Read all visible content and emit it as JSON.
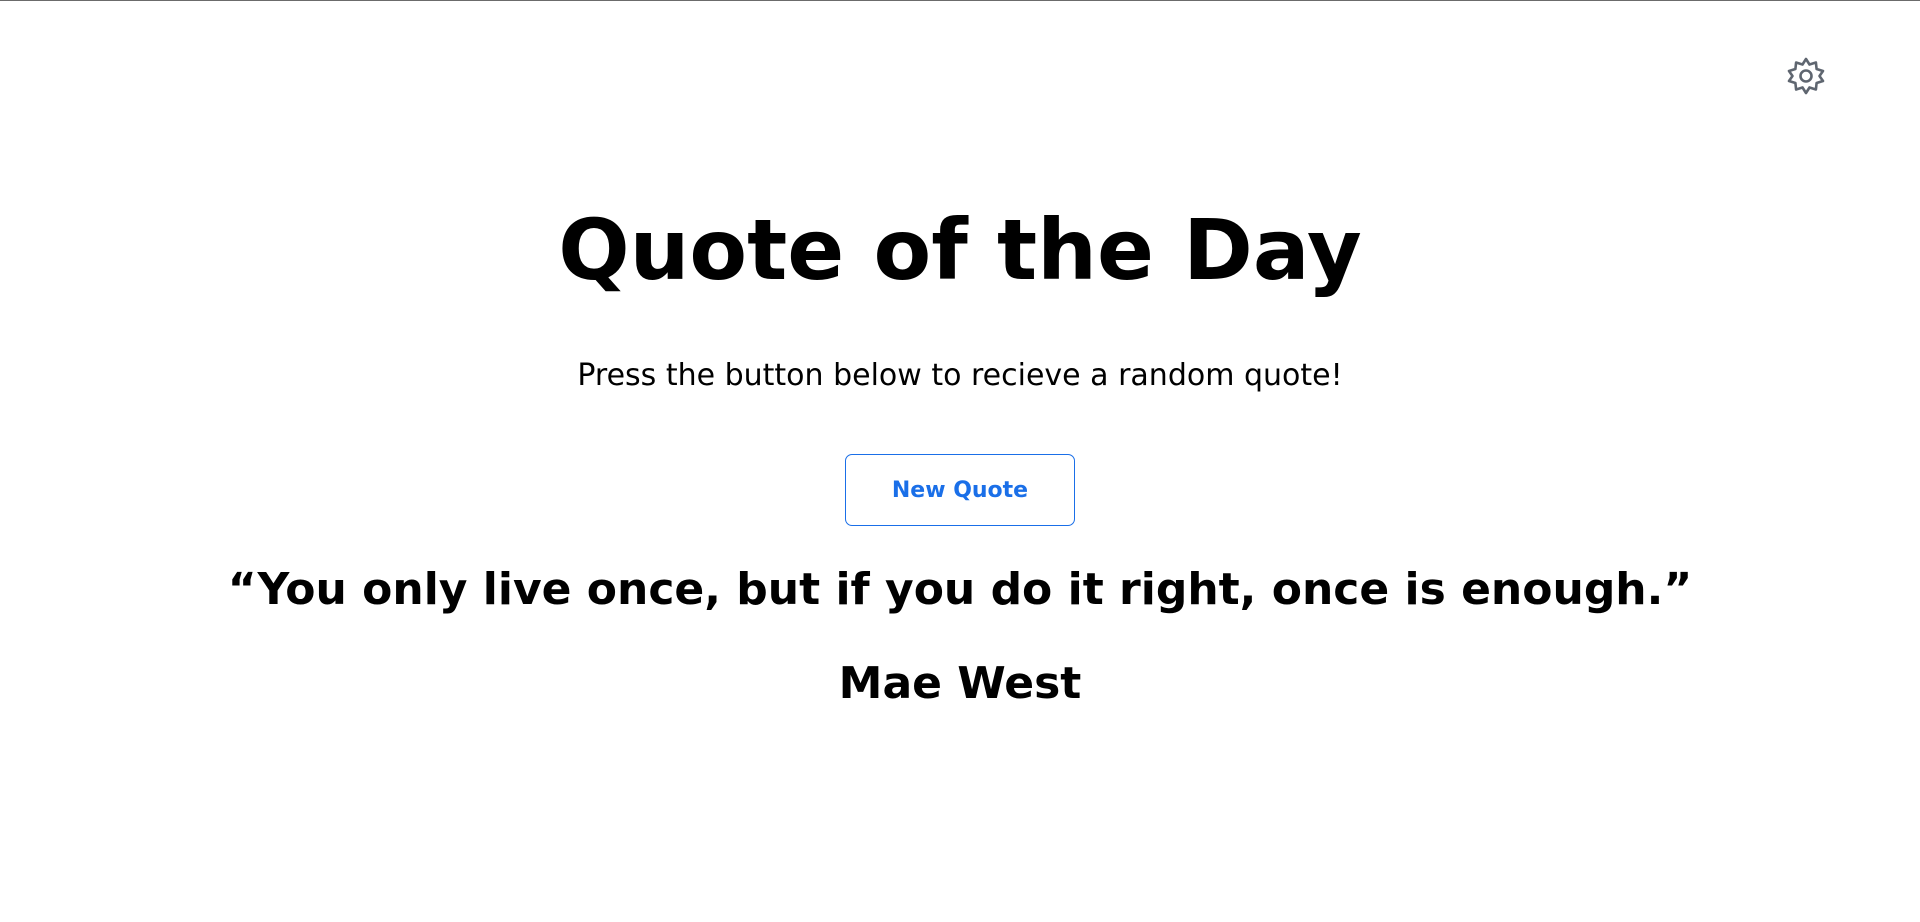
{
  "header": {
    "settings_icon": "gear-icon",
    "settings_color": "#5f6670"
  },
  "main": {
    "title": "Quote of the Day",
    "subtitle": "Press the button below to recieve a random quote!",
    "button_label": "New Quote",
    "accent_color": "#1a6fe8"
  },
  "quote": {
    "text": "“You only live once, but if you do it right, once is enough.”",
    "author": "Mae West"
  }
}
